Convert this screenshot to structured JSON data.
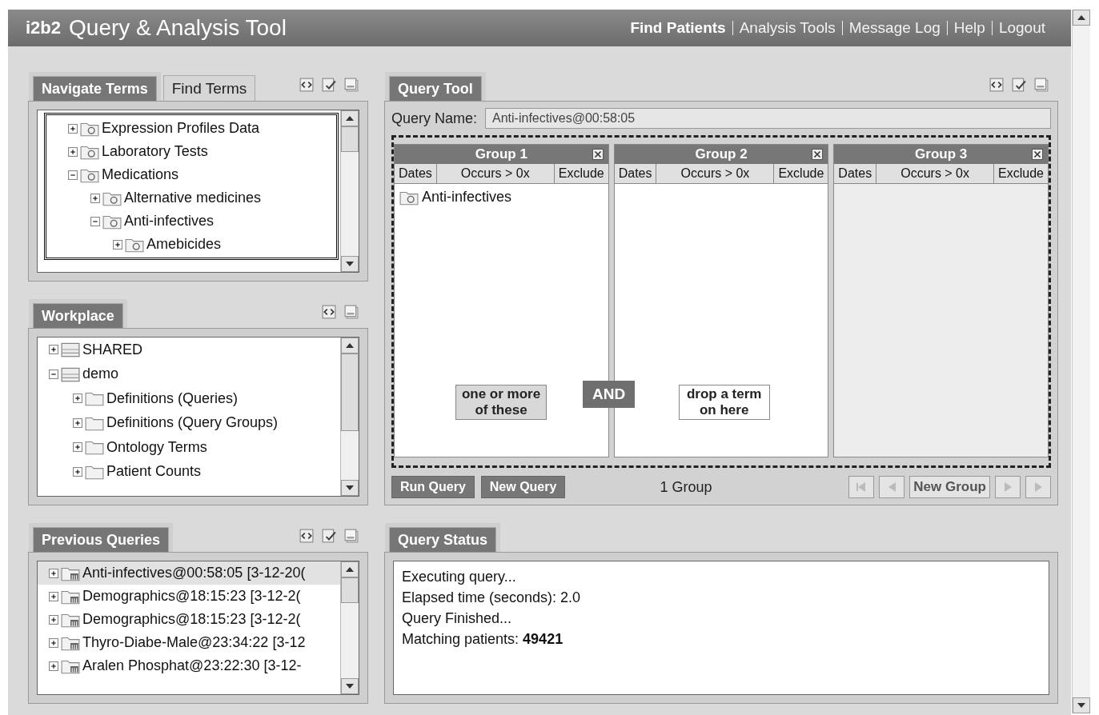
{
  "header": {
    "logo": "i2b2",
    "title": "Query & Analysis Tool",
    "nav": [
      {
        "label": "Find Patients",
        "selected": true
      },
      {
        "label": "Analysis Tools",
        "selected": false
      },
      {
        "label": "Message Log",
        "selected": false
      },
      {
        "label": "Help",
        "selected": false
      },
      {
        "label": "Logout",
        "selected": false
      }
    ]
  },
  "navigate_terms": {
    "tabs": [
      {
        "label": "Navigate Terms",
        "selected": true
      },
      {
        "label": "Find Terms",
        "selected": false
      }
    ],
    "tree": [
      {
        "label": "Expression Profiles Data",
        "kind": "term",
        "expanded": false
      },
      {
        "label": "Laboratory Tests",
        "kind": "term",
        "expanded": false
      },
      {
        "label": "Medications",
        "kind": "term",
        "expanded": true,
        "children": [
          {
            "label": "Alternative medicines",
            "kind": "term",
            "expanded": false
          },
          {
            "label": "Anti-infectives",
            "kind": "term",
            "expanded": true,
            "children": [
              {
                "label": "Amebicides",
                "kind": "term",
                "expanded": false
              }
            ]
          }
        ]
      }
    ]
  },
  "workplace": {
    "tabs": [
      {
        "label": "Workplace",
        "selected": true
      }
    ],
    "tree": [
      {
        "label": "SHARED",
        "kind": "drawer",
        "expanded": false
      },
      {
        "label": "demo",
        "kind": "drawer",
        "expanded": true,
        "children": [
          {
            "label": "Definitions (Queries)",
            "kind": "folder",
            "expanded": false
          },
          {
            "label": "Definitions (Query Groups)",
            "kind": "folder",
            "expanded": false
          },
          {
            "label": "Ontology Terms",
            "kind": "folder",
            "expanded": false
          },
          {
            "label": "Patient Counts",
            "kind": "folder",
            "expanded": false
          }
        ]
      }
    ]
  },
  "previous_queries": {
    "tabs": [
      {
        "label": "Previous Queries",
        "selected": true
      }
    ],
    "items": [
      {
        "label": "Anti-infectives@00:58:05 [3-12-20(",
        "selected": true
      },
      {
        "label": "Demographics@18:15:23 [3-12-2(",
        "selected": false
      },
      {
        "label": "Demographics@18:15:23 [3-12-2(",
        "selected": false
      },
      {
        "label": "Thyro-Diabe-Male@23:34:22 [3-12",
        "selected": false
      },
      {
        "label": "Aralen Phosphat@23:22:30 [3-12-",
        "selected": false
      }
    ]
  },
  "query_tool": {
    "tabs": [
      {
        "label": "Query Tool",
        "selected": true
      }
    ],
    "query_name_label": "Query Name:",
    "query_name": "Anti-infectives@00:58:05",
    "groups": [
      {
        "title": "Group 1",
        "columns": [
          "Dates",
          "Occurs > 0x",
          "Exclude"
        ],
        "items": [
          "Anti-infectives"
        ],
        "hint": "one or more of these",
        "disabled": false
      },
      {
        "title": "Group 2",
        "columns": [
          "Dates",
          "Occurs > 0x",
          "Exclude"
        ],
        "hint": "drop a term on here",
        "disabled": false
      },
      {
        "title": "Group 3",
        "columns": [
          "Dates",
          "Occurs > 0x",
          "Exclude"
        ],
        "disabled": true
      }
    ],
    "connector": "AND",
    "buttons": [
      "Run Query",
      "New Query"
    ],
    "group_count": "1 Group",
    "nav_buttons": [
      {
        "kind": "first",
        "disabled": true
      },
      {
        "kind": "prev",
        "disabled": true
      },
      {
        "kind": "label",
        "label": "New Group",
        "disabled": false
      },
      {
        "kind": "next",
        "disabled": true
      },
      {
        "kind": "last",
        "disabled": true
      }
    ]
  },
  "query_status": {
    "tabs": [
      {
        "label": "Query Status",
        "selected": true
      }
    ],
    "lines": [
      "Executing query...",
      "Elapsed time (seconds): 2.0",
      "Query Finished...",
      "Matching patients:  **49421**"
    ]
  }
}
